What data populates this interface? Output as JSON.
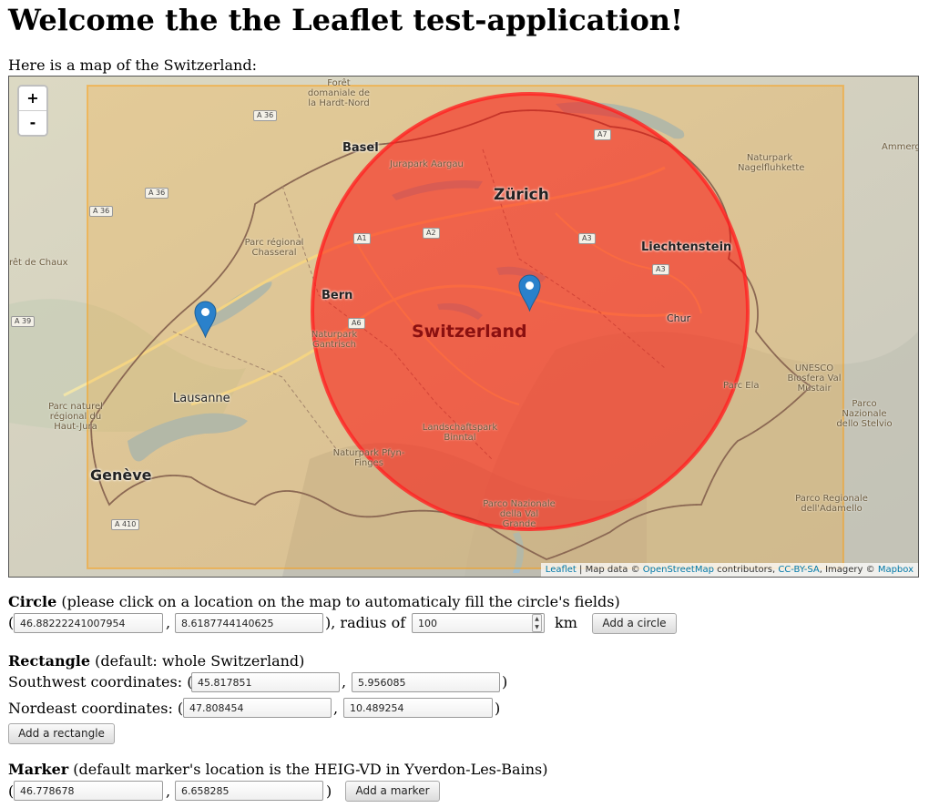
{
  "page": {
    "title": "Welcome the the Leaflet test-application!",
    "intro": "Here is a map of the Switzerland:"
  },
  "map": {
    "zoom_in": "+",
    "zoom_out": "-",
    "attribution": {
      "leaflet": "Leaflet",
      "sep1": " | Map data © ",
      "osm": "OpenStreetMap",
      "sep2": " contributors, ",
      "license": "CC-BY-SA",
      "sep3": ", Imagery © ",
      "mapbox": "Mapbox"
    },
    "labels": {
      "basel": "Basel",
      "zurich": "Zürich",
      "bern": "Bern",
      "lausanne": "Lausanne",
      "geneve": "Genève",
      "liechtenstein": "Liechtenstein",
      "chur": "Chur",
      "switzerland": "Switzerland",
      "ammer": "Ammerg",
      "jurapark": "Jurapark Aargau",
      "foret": "Forêt domaniale de la Hardt-Nord",
      "chasseral": "Parc régional Chasseral",
      "chaux": "rêt de Chaux",
      "gantrisch": "Naturpark Gantrisch",
      "jura": "Parc naturel régional du Haut-Jura",
      "binntal": "Landschaftspark Binntal",
      "pfyn": "Naturpark Pfyn-Finges",
      "valgrande": "Parco Nazionale della Val Grande",
      "stelvio": "Parco Nazionale dello Stelvio",
      "adamello": "Parco Regionale dell'Adamello",
      "munstair": "UNESCO Biosfera Val Müstair",
      "nagelfluh": "Naturpark Nagelfluhkette",
      "parcela": "Parc Ela",
      "a36a": "A 36",
      "a36b": "A 36",
      "a36c": "A 36",
      "a39": "A 39",
      "a410": "A 410",
      "a1": "A1",
      "a2": "A2",
      "a3a": "A3",
      "a3b": "A3",
      "a6": "A6",
      "a7": "A7"
    }
  },
  "circle_form": {
    "heading": "Circle",
    "hint": " (please click on a location on the map to automaticaly fill the circle's fields)",
    "lat": "46.88222241007954",
    "lng": "8.6187744140625",
    "radius_label": "), radius of",
    "radius": "100",
    "unit": "km",
    "button": "Add a circle"
  },
  "rectangle_form": {
    "heading": "Rectangle",
    "hint": " (default: whole Switzerland)",
    "sw_label": "Southwest coordinates: (",
    "sw_lat": "45.817851",
    "sw_lng": "5.956085",
    "ne_label": "Nordeast coordinates: (",
    "ne_lat": "47.808454",
    "ne_lng": "10.489254",
    "button": "Add a rectangle"
  },
  "marker_form": {
    "heading": "Marker",
    "hint": " (default marker's location is the HEIG-VD in Yverdon-Les-Bains)",
    "lat": "46.778678",
    "lng": "6.658285",
    "button": "Add a marker"
  },
  "punct": {
    "open": "(",
    "comma": ",",
    "close": ")"
  }
}
